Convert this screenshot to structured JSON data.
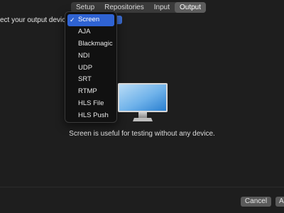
{
  "tabs": [
    {
      "label": "Setup",
      "active": false
    },
    {
      "label": "Repositories",
      "active": false
    },
    {
      "label": "Input",
      "active": false
    },
    {
      "label": "Output",
      "active": true
    }
  ],
  "prompt": {
    "label": "ect your output devic"
  },
  "output_menu": {
    "selected": "Screen",
    "options": [
      "Screen",
      "AJA",
      "Blackmagic",
      "NDI",
      "UDP",
      "SRT",
      "RTMP",
      "HLS File",
      "HLS Push"
    ]
  },
  "preview": {
    "icon": "monitor-icon",
    "helper_text": "Screen is useful for testing without any device."
  },
  "footer": {
    "cancel_label": "Cancel",
    "next_label": "A"
  },
  "colors": {
    "accent": "#2f63d3",
    "background": "#1e1e1e",
    "menu_background": "#111111"
  }
}
